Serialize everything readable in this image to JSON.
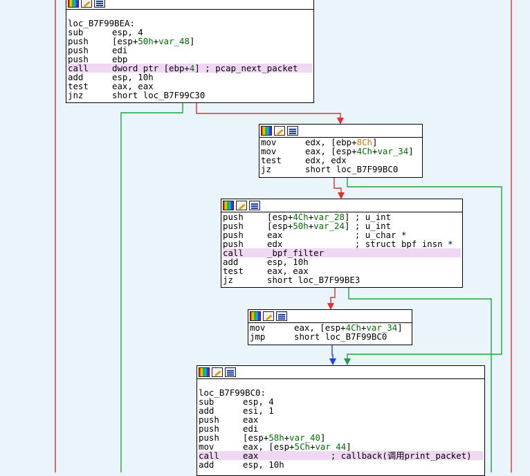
{
  "colors": {
    "background": "#eaf4fb",
    "edge_false": "#e03030",
    "edge_true": "#20a040",
    "edge_jump": "#2040ff",
    "call_highlight": "#f0d8f4"
  },
  "icons": [
    "graph-overview-icon",
    "edit-node-icon",
    "xrefs-icon"
  ],
  "blocks": {
    "b1": {
      "label": "loc_B7F99BEA:",
      "lines": [
        {
          "mn": "sub",
          "op": "esp, 4"
        },
        {
          "mn": "push",
          "op": "[esp+50h+var_48]"
        },
        {
          "mn": "push",
          "op": "edi"
        },
        {
          "mn": "push",
          "op": "ebp"
        },
        {
          "mn": "call",
          "op": "dword ptr [ebp+4] ; pcap_next_packet",
          "hl": true
        },
        {
          "mn": "add",
          "op": "esp, 10h"
        },
        {
          "mn": "test",
          "op": "eax, eax"
        },
        {
          "mn": "jnz",
          "op": "short loc_B7F99C30"
        }
      ]
    },
    "b2": {
      "lines": [
        {
          "mn": "mov",
          "op": "edx, [ebp+8Ch]"
        },
        {
          "mn": "mov",
          "op": "eax, [esp+4Ch+var_34]"
        },
        {
          "mn": "test",
          "op": "edx, edx"
        },
        {
          "mn": "jz",
          "op": "short loc_B7F99BC0"
        }
      ]
    },
    "b3": {
      "lines": [
        {
          "mn": "push",
          "op": "[esp+4Ch+var_28] ; u_int"
        },
        {
          "mn": "push",
          "op": "[esp+50h+var_24] ; u_int"
        },
        {
          "mn": "push",
          "op": "eax              ; u_char *"
        },
        {
          "mn": "push",
          "op": "edx              ; struct bpf_insn *"
        },
        {
          "mn": "call",
          "op": "_bpf_filter",
          "hl": true
        },
        {
          "mn": "add",
          "op": "esp, 10h"
        },
        {
          "mn": "test",
          "op": "eax, eax"
        },
        {
          "mn": "jz",
          "op": "short loc_B7F99BE3"
        }
      ]
    },
    "b4": {
      "lines": [
        {
          "mn": "mov",
          "op": "eax, [esp+4Ch+var_34]"
        },
        {
          "mn": "jmp",
          "op": "short loc_B7F99BC0"
        }
      ]
    },
    "b5": {
      "label": "loc_B7F99BC0:",
      "lines": [
        {
          "mn": "sub",
          "op": "esp, 4"
        },
        {
          "mn": "add",
          "op": "esi, 1"
        },
        {
          "mn": "push",
          "op": "eax"
        },
        {
          "mn": "push",
          "op": "edi"
        },
        {
          "mn": "push",
          "op": "[esp+58h+var_40]"
        },
        {
          "mn": "mov",
          "op": "eax, [esp+5Ch+var_44]"
        },
        {
          "mn": "call",
          "op": "eax              ; callback(调用print_packet)",
          "hl": true
        },
        {
          "mn": "add",
          "op": "esp, 10h"
        }
      ]
    }
  }
}
